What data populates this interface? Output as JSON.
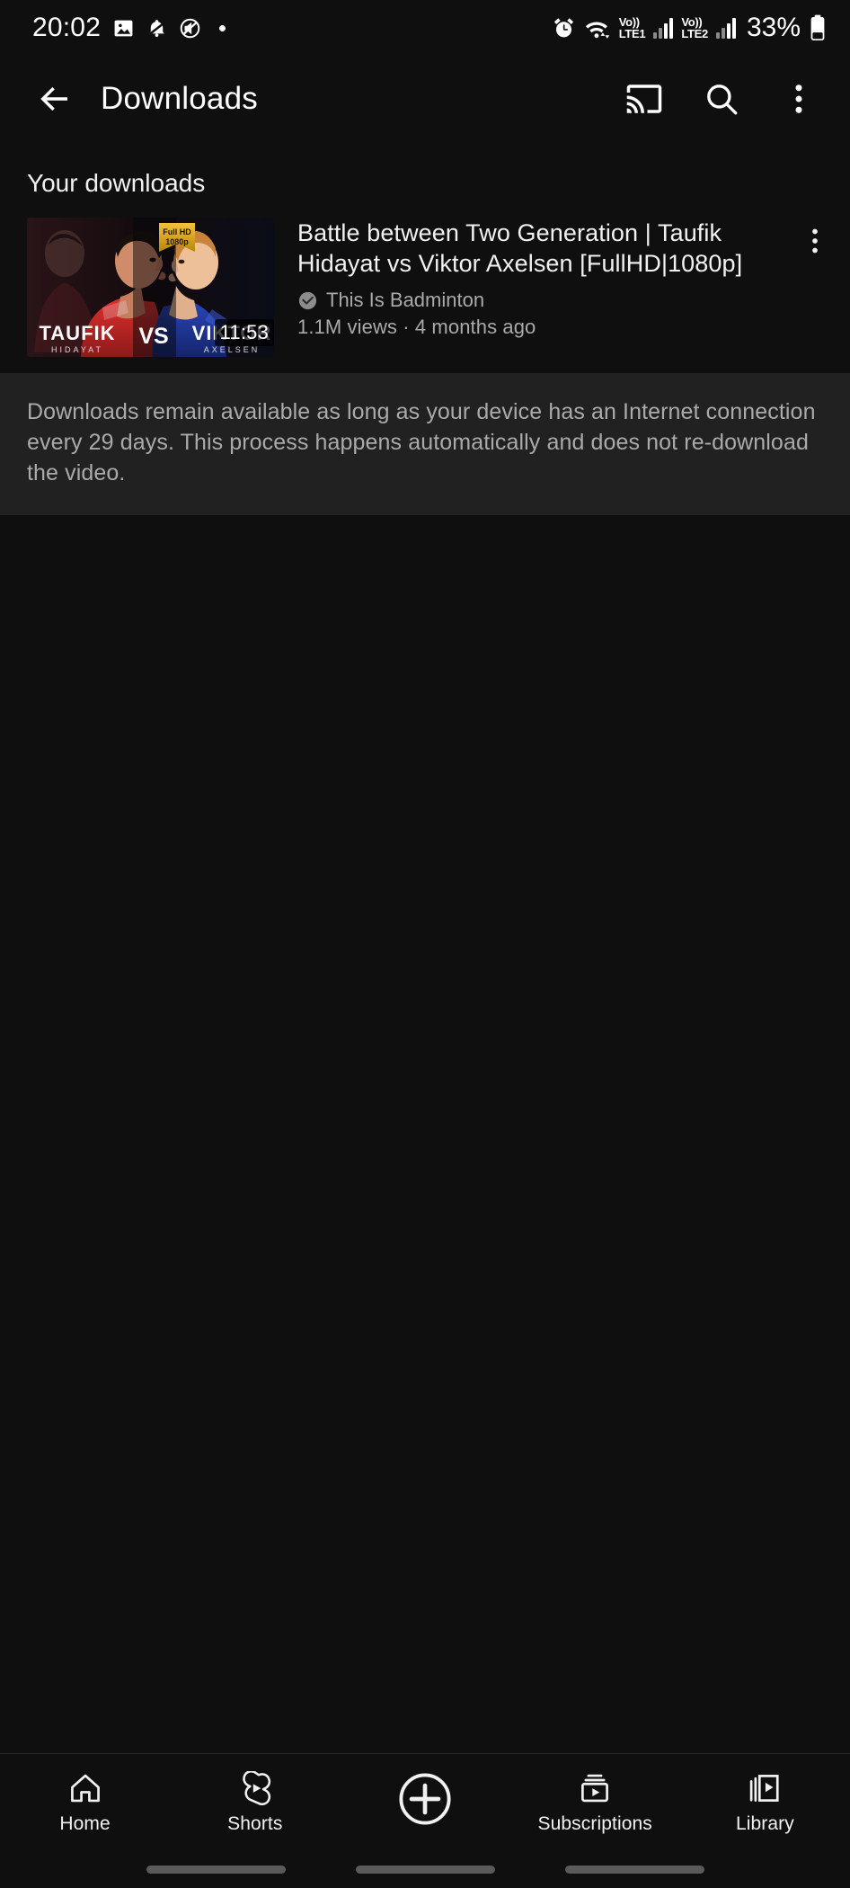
{
  "status_bar": {
    "time": "20:02",
    "left_icons": [
      "image-icon",
      "do-not-disturb-icon",
      "mute-icon"
    ],
    "right_icons": [
      "alarm-icon",
      "wifi-icon"
    ],
    "sim1_label_top": "Vo))",
    "sim1_label_bottom": "LTE1",
    "sim2_label_top": "Vo))",
    "sim2_label_bottom": "LTE2",
    "battery_percent": "33%"
  },
  "app_bar": {
    "title": "Downloads",
    "back_icon": "arrow-back-icon",
    "cast_icon": "cast-icon",
    "search_icon": "search-icon",
    "overflow_icon": "more-vertical-icon"
  },
  "main": {
    "section_heading": "Your downloads",
    "video": {
      "title": "Battle between Two Generation | Taufik Hidayat vs Viktor Axelsen [FullHD|1080p]",
      "channel": "This Is Badminton",
      "verified_icon": "verified-check-icon",
      "stats": "1.1M views · 4 months ago",
      "duration": "11:53",
      "menu_icon": "more-vertical-icon",
      "thumbnail": {
        "left_name": "TAUFIK",
        "left_sub": "HIDAYAT",
        "vs": "VS",
        "right_name": "VIKTOR",
        "right_sub": "AXELSEN",
        "quality_badge_top": "Full HD",
        "quality_badge_bottom": "1080p"
      }
    },
    "info_banner": "Downloads remain available as long as your device has an Internet connection every 29 days. This process happens automatically and does not re-download the video."
  },
  "bottom_nav": {
    "items": [
      {
        "label": "Home",
        "icon": "home-icon"
      },
      {
        "label": "Shorts",
        "icon": "shorts-icon"
      },
      {
        "label": "",
        "icon": "create-plus-icon"
      },
      {
        "label": "Subscriptions",
        "icon": "subscriptions-icon"
      },
      {
        "label": "Library",
        "icon": "library-icon"
      }
    ]
  },
  "colors": {
    "background": "#0f0f0f",
    "banner_background": "#212121",
    "primary_text": "#f1f1f1",
    "secondary_text": "#aaaaaa",
    "divider": "#272727"
  }
}
